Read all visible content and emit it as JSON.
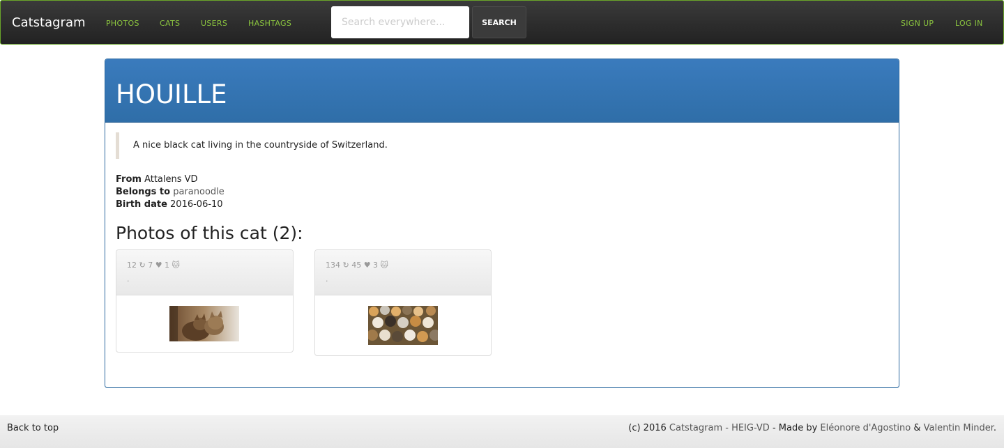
{
  "nav": {
    "brand": "Catstagram",
    "links": [
      "PHOTOS",
      "CATS",
      "USERS",
      "HASHTAGS"
    ],
    "search_placeholder": "Search everywhere...",
    "search_button": "SEARCH",
    "signup": "SIGN UP",
    "login": "LOG IN"
  },
  "cat": {
    "name": "HOUILLE",
    "description": "A nice black cat living in the countryside of Switzerland.",
    "from_label": "From",
    "from_value": "Attalens VD",
    "belongs_label": "Belongs to",
    "belongs_value": "paranoodle",
    "birth_label": "Birth date",
    "birth_value": "2016-06-10"
  },
  "photos": {
    "title": "Photos of this cat (2):",
    "items": [
      {
        "stats": "12 ↻ 7 ♥ 1 🐱",
        "caption": "."
      },
      {
        "stats": "134 ↻ 45 ♥ 3 🐱",
        "caption": "."
      }
    ]
  },
  "footer": {
    "back_to_top": "Back to top",
    "credits_prefix": "(c) 2016",
    "credits_site": "Catstagram - HEIG-VD",
    "credits_made_by": "- Made by",
    "credits_author1": "Eléonore d'Agostino",
    "credits_and": "&",
    "credits_author2": "Valentin Minder",
    "credits_end": "."
  },
  "colors": {
    "accent_green": "#8cc63f",
    "panel_blue": "#337ab7"
  }
}
